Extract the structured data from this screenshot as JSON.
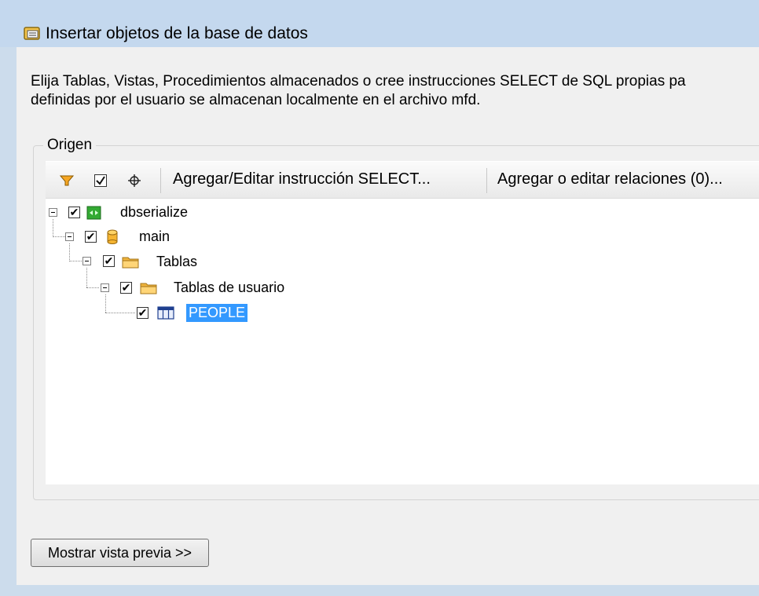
{
  "window": {
    "title": "Insertar objetos de la base de datos",
    "accent_color": "#3399ff"
  },
  "description": {
    "line1": "Elija Tablas, Vistas, Procedimientos almacenados o cree instrucciones SELECT de SQL propias pa",
    "line2": "definidas por el usuario se almacenan localmente en el archivo mfd."
  },
  "source_group": {
    "label": "Origen",
    "toolbar": {
      "filter_icon": "filter-icon",
      "check_icon": "checkmark-icon",
      "locate_icon": "crosshair-icon",
      "select_statement_label": "Agregar/Editar instrucción SELECT...",
      "relations_label": "Agregar o editar relaciones (0)..."
    },
    "tree": [
      {
        "label": "dbserialize",
        "icon": "database-connection-icon",
        "checked": true
      },
      {
        "label": "main",
        "icon": "database-icon",
        "checked": true
      },
      {
        "label": "Tablas",
        "icon": "folder-icon",
        "checked": true
      },
      {
        "label": "Tablas de usuario",
        "icon": "folder-icon",
        "checked": true
      },
      {
        "label": "PEOPLE",
        "icon": "table-icon",
        "checked": true,
        "selected": true
      }
    ]
  },
  "footer": {
    "preview_button_label": "Mostrar vista previa >>"
  }
}
